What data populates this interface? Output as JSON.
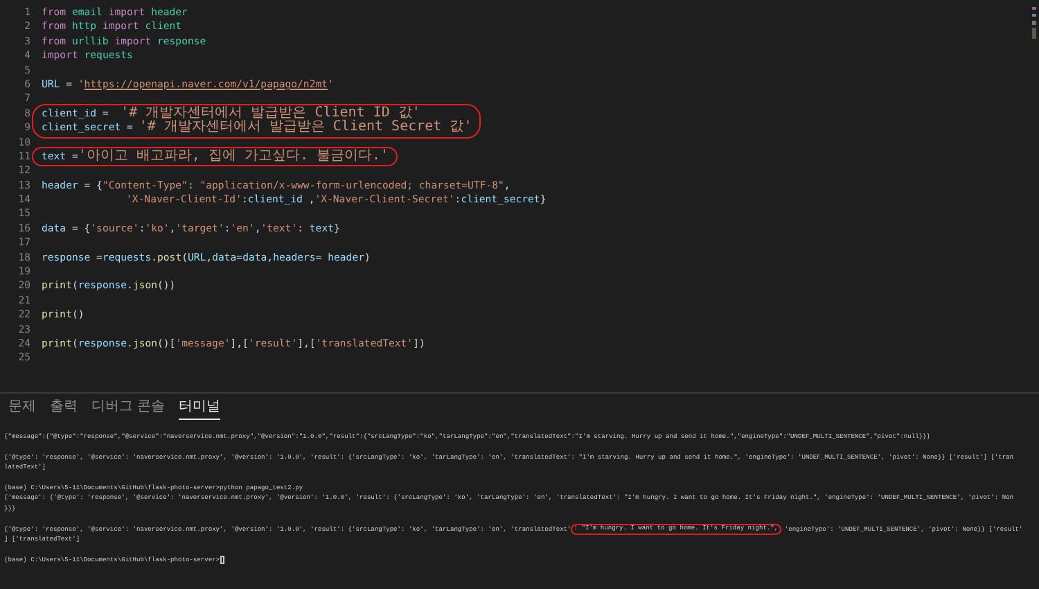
{
  "editor": {
    "lines": [
      {
        "num": "1",
        "tokens": [
          {
            "kind": "keyword",
            "text": "from "
          },
          {
            "kind": "module",
            "text": "email "
          },
          {
            "kind": "keyword",
            "text": "import "
          },
          {
            "kind": "module",
            "text": "header"
          }
        ],
        "circled": false
      },
      {
        "num": "2",
        "tokens": [
          {
            "kind": "keyword",
            "text": "from "
          },
          {
            "kind": "module",
            "text": "http "
          },
          {
            "kind": "keyword",
            "text": "import "
          },
          {
            "kind": "module",
            "text": "client"
          }
        ],
        "circled": false
      },
      {
        "num": "3",
        "tokens": [
          {
            "kind": "keyword",
            "text": "from "
          },
          {
            "kind": "module",
            "text": "urllib "
          },
          {
            "kind": "keyword",
            "text": "import "
          },
          {
            "kind": "module",
            "text": "response"
          }
        ],
        "circled": false
      },
      {
        "num": "4",
        "tokens": [
          {
            "kind": "keyword",
            "text": "import "
          },
          {
            "kind": "module",
            "text": "requests"
          }
        ],
        "circled": false
      },
      {
        "num": "5",
        "circled": false
      },
      {
        "num": "6",
        "tokens": [
          {
            "kind": "variable",
            "text": "URL"
          },
          {
            "kind": "plain",
            "text": " = "
          },
          {
            "kind": "string",
            "text": "'"
          },
          {
            "kind": "url",
            "text": "https://openapi.naver.com/v1/papago/n2mt"
          },
          {
            "kind": "string",
            "text": "'"
          }
        ],
        "circled": false
      },
      {
        "num": "7",
        "circled": false
      },
      {
        "num": "8",
        "tokens": [
          {
            "kind": "variable",
            "text": "client_id"
          },
          {
            "kind": "plain",
            "text": " =  "
          },
          {
            "kind": "string",
            "text": "'# 개발자센터에서 발급받은 Client ID 값'"
          }
        ],
        "circled": true
      },
      {
        "num": "9",
        "tokens": [
          {
            "kind": "variable",
            "text": "client_secret"
          },
          {
            "kind": "plain",
            "text": " = "
          },
          {
            "kind": "string",
            "text": "'# 개발자센터에서 발급받은 Client Secret 값'"
          }
        ],
        "circled": true
      },
      {
        "num": "10",
        "circled": false
      },
      {
        "num": "11",
        "tokens": [
          {
            "kind": "variable",
            "text": "text"
          },
          {
            "kind": "plain",
            "text": " ="
          },
          {
            "kind": "string",
            "text": "'아이고 배고파라, 집에 가고싶다. 불금이다.'"
          }
        ],
        "circled": true
      },
      {
        "num": "12",
        "circled": false
      },
      {
        "num": "13",
        "tokens": [
          {
            "kind": "variable",
            "text": "header"
          },
          {
            "kind": "plain",
            "text": " = {"
          },
          {
            "kind": "string",
            "text": "\"Content-Type\""
          },
          {
            "kind": "plain",
            "text": ": "
          },
          {
            "kind": "string",
            "text": "\"application/x-www-form-urlencoded; charset=UTF-8\""
          },
          {
            "kind": "plain",
            "text": ","
          }
        ],
        "circled": false
      },
      {
        "num": "14",
        "indented": true,
        "tokens": [
          {
            "kind": "string",
            "text": "'X-Naver-Client-Id'"
          },
          {
            "kind": "plain",
            "text": ":"
          },
          {
            "kind": "variable",
            "text": "client_id"
          },
          {
            "kind": "plain",
            "text": " ,"
          },
          {
            "kind": "string",
            "text": "'X-Naver-Client-Secret'"
          },
          {
            "kind": "plain",
            "text": ":"
          },
          {
            "kind": "variable",
            "text": "client_secret"
          },
          {
            "kind": "plain",
            "text": "}"
          }
        ],
        "circled": false
      },
      {
        "num": "15",
        "circled": false
      },
      {
        "num": "16",
        "tokens": [
          {
            "kind": "variable",
            "text": "data"
          },
          {
            "kind": "plain",
            "text": " = {"
          },
          {
            "kind": "string",
            "text": "'source'"
          },
          {
            "kind": "plain",
            "text": ":"
          },
          {
            "kind": "string",
            "text": "'ko'"
          },
          {
            "kind": "plain",
            "text": ","
          },
          {
            "kind": "string",
            "text": "'target'"
          },
          {
            "kind": "plain",
            "text": ":"
          },
          {
            "kind": "string",
            "text": "'en'"
          },
          {
            "kind": "plain",
            "text": ","
          },
          {
            "kind": "string",
            "text": "'text'"
          },
          {
            "kind": "plain",
            "text": ": "
          },
          {
            "kind": "variable",
            "text": "text"
          },
          {
            "kind": "plain",
            "text": "}"
          }
        ],
        "circled": false
      },
      {
        "num": "17",
        "circled": false
      },
      {
        "num": "18",
        "tokens": [
          {
            "kind": "variable",
            "text": "response"
          },
          {
            "kind": "plain",
            "text": " ="
          },
          {
            "kind": "variable",
            "text": "requests"
          },
          {
            "kind": "plain",
            "text": "."
          },
          {
            "kind": "function",
            "text": "post"
          },
          {
            "kind": "plain",
            "text": "("
          },
          {
            "kind": "variable",
            "text": "URL"
          },
          {
            "kind": "plain",
            "text": ","
          },
          {
            "kind": "variable",
            "text": "data"
          },
          {
            "kind": "plain",
            "text": "="
          },
          {
            "kind": "variable",
            "text": "data"
          },
          {
            "kind": "plain",
            "text": ","
          },
          {
            "kind": "variable",
            "text": "headers"
          },
          {
            "kind": "plain",
            "text": "= "
          },
          {
            "kind": "variable",
            "text": "header"
          },
          {
            "kind": "plain",
            "text": ")"
          }
        ],
        "circled": false
      },
      {
        "num": "19",
        "circled": false
      },
      {
        "num": "20",
        "tokens": [
          {
            "kind": "function",
            "text": "print"
          },
          {
            "kind": "plain",
            "text": "("
          },
          {
            "kind": "variable",
            "text": "response"
          },
          {
            "kind": "plain",
            "text": "."
          },
          {
            "kind": "function",
            "text": "json"
          },
          {
            "kind": "plain",
            "text": "())"
          }
        ],
        "circled": false
      },
      {
        "num": "21",
        "circled": false
      },
      {
        "num": "22",
        "tokens": [
          {
            "kind": "function",
            "text": "print"
          },
          {
            "kind": "plain",
            "text": "()"
          }
        ],
        "circled": false
      },
      {
        "num": "23",
        "circled": false
      },
      {
        "num": "24",
        "tokens": [
          {
            "kind": "function",
            "text": "print"
          },
          {
            "kind": "plain",
            "text": "("
          },
          {
            "kind": "variable",
            "text": "response"
          },
          {
            "kind": "plain",
            "text": "."
          },
          {
            "kind": "function",
            "text": "json"
          },
          {
            "kind": "plain",
            "text": "()["
          },
          {
            "kind": "string",
            "text": "'message'"
          },
          {
            "kind": "plain",
            "text": "],["
          },
          {
            "kind": "string",
            "text": "'result'"
          },
          {
            "kind": "plain",
            "text": "],["
          },
          {
            "kind": "string",
            "text": "'translatedText'"
          },
          {
            "kind": "plain",
            "text": "])"
          }
        ],
        "circled": false
      },
      {
        "num": "25",
        "circled": false
      }
    ]
  },
  "panel": {
    "tabs": [
      {
        "label": "문제",
        "selected": false
      },
      {
        "label": "출력",
        "selected": false
      },
      {
        "label": "디버그 콘솔",
        "selected": false
      },
      {
        "label": "터미널",
        "selected": true
      }
    ],
    "terminal": [
      {
        "lines": [
          {
            "segments": [
              {
                "text": "{\"message\":{\"@type\":\"response\",\"@service\":\"naverservice.nmt.proxy\",\"@version\":\"1.0.0\",\"result\":{\"srcLangType\":\"ko\",\"tarLangType\":\"en\",\"translatedText\":\"I'm starving. Hurry up and send it home.\",\"engineType\":\"UNDEF_MULTI_SENTENCE\",\"pivot\":null}}}",
                "circled": false
              }
            ]
          }
        ]
      },
      {
        "lines": [
          {
            "segments": [
              {
                "text": "{'@type': 'response', '@service': 'naverservice.nmt.proxy', '@version': '1.0.0', 'result': {'srcLangType': 'ko', 'tarLangType': 'en', 'translatedText': \"I'm starving. Hurry up and send it home.\", 'engineType': 'UNDEF_MULTI_SENTENCE', 'pivot': None}} ['result'] ['tran",
                "circled": false
              }
            ]
          },
          {
            "segments": [
              {
                "text": "latedText']",
                "circled": false
              }
            ]
          }
        ]
      },
      {
        "lines": [
          {
            "segments": [
              {
                "text": "(base) C:\\Users\\5-11\\Documents\\GitHub\\flask-photo-server>python papago_test2.py",
                "circled": false
              }
            ]
          },
          {
            "segments": [
              {
                "text": "{'message': {'@type': 'response', '@service': 'naverservice.nmt.proxy', '@version': '1.0.0', 'result': {'srcLangType': 'ko', 'tarLangType': 'en', 'translatedText': \"I'm hungry. I want to go home. It's Friday night.\", 'engineType': 'UNDEF_MULTI_SENTENCE', 'pivot': Non",
                "circled": false
              }
            ]
          },
          {
            "segments": [
              {
                "text": "}}}",
                "circled": false
              }
            ]
          }
        ]
      },
      {
        "lines": [
          {
            "segments": [
              {
                "text": "{'@type': 'response', '@service': 'naverservice.nmt.proxy', '@version': '1.0.0', 'result': {'srcLangType': 'ko', 'tarLangType': 'en', 'translatedText'",
                "circled": false
              },
              {
                "text": ": \"I'm hungry. I want to go home. It's Friday night.\",",
                "circled": true
              },
              {
                "text": " 'engineType': 'UNDEF_MULTI_SENTENCE', 'pivot': None}} ['result'",
                "circled": false
              }
            ]
          },
          {
            "segments": [
              {
                "text": "] ['translatedText']",
                "circled": false
              }
            ]
          }
        ]
      },
      {
        "lines": [
          {
            "segments": [
              {
                "text": "(base) C:\\Users\\5-11\\Documents\\GitHub\\flask-photo-server>",
                "circled": false
              }
            ],
            "cursor": true
          }
        ]
      }
    ]
  }
}
